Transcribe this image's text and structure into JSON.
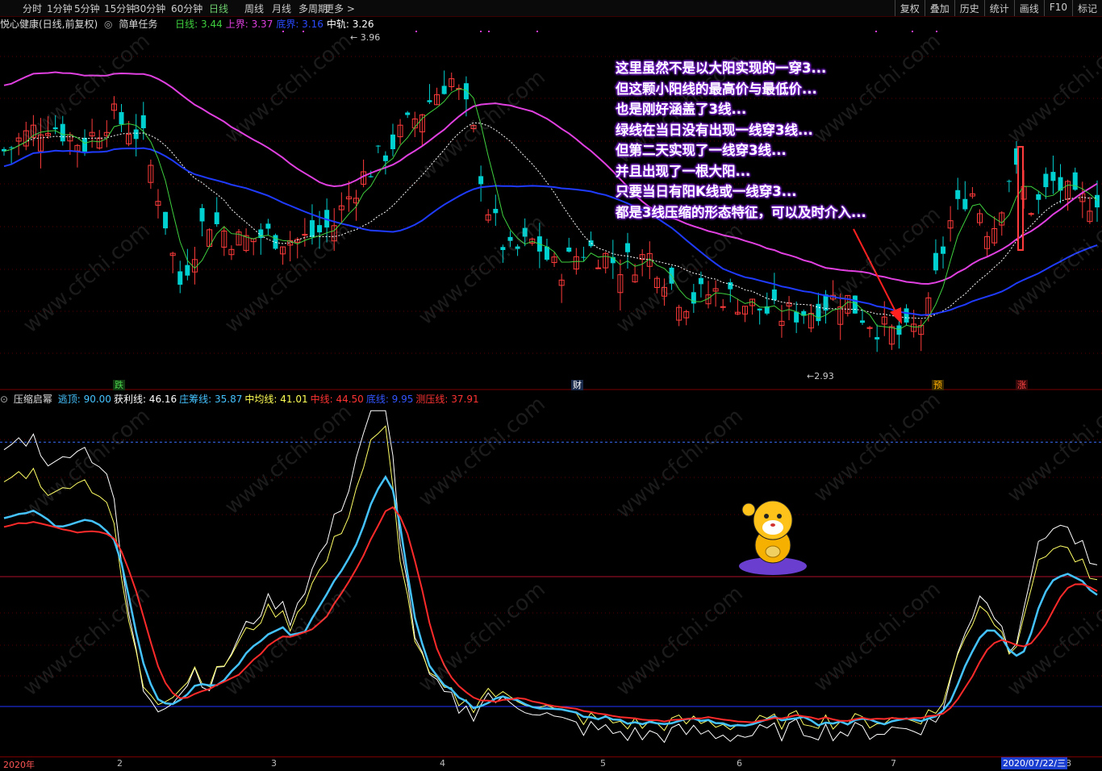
{
  "toolbar": {
    "periods": [
      "分时",
      "1分钟",
      "5分钟",
      "15分钟",
      "30分钟",
      "60分钟",
      "日线",
      "周线",
      "月线",
      "多周期",
      "更多 >"
    ],
    "active": "日线",
    "right_buttons": [
      "复权",
      "叠加",
      "历史",
      "统计",
      "画线",
      "F10",
      "标记"
    ]
  },
  "main_info": {
    "stock": "悦心健康(日线,前复权)",
    "task": "简单任务",
    "items": [
      {
        "label": "日线: 3.44",
        "color": "#3fd13f"
      },
      {
        "label": "上界: 3.37",
        "color": "#e040e0"
      },
      {
        "label": "底界: 3.16",
        "color": "#2a4bff"
      },
      {
        "label": "中轨: 3.26",
        "color": "#ffffff"
      }
    ]
  },
  "indicator_info": {
    "name": "压缩启幂",
    "items": [
      {
        "label": "逃顶: 90.00",
        "color": "#45c3ff"
      },
      {
        "label": "获利线: 46.16",
        "color": "#ffffff"
      },
      {
        "label": "庄筹线: 35.87",
        "color": "#45c3ff"
      },
      {
        "label": "中均线: 41.01",
        "color": "#ffff55"
      },
      {
        "label": "中线: 44.50",
        "color": "#ff3333"
      },
      {
        "label": "底线: 9.95",
        "color": "#3355ff"
      },
      {
        "label": "测压线: 37.91",
        "color": "#ff3333"
      }
    ]
  },
  "price_labels": {
    "high": "3.96",
    "low": "2.93"
  },
  "event_badges": [
    {
      "text": "跌",
      "color": "#4ad04a",
      "bg": "#123a12"
    },
    {
      "text": "财",
      "color": "#ffffff",
      "bg": "#1a2a4a"
    },
    {
      "text": "预",
      "color": "#ffb000",
      "bg": "#3a2a00"
    },
    {
      "text": "涨",
      "color": "#ff4444",
      "bg": "#3a0a0a"
    }
  ],
  "annotation": [
    "这里虽然不是以大阳实现的一穿3...",
    "但这颗小阳线的最高价与最低价...",
    "也是刚好涵盖了3线...",
    "绿线在当日没有出现一线穿3线...",
    "但第二天实现了一线穿3线...",
    "并且出现了一根大阳...",
    "只要当日有阳K线或一线穿3...",
    "都是3线压缩的形态特征，可以及时介入..."
  ],
  "x_axis": [
    "2020年",
    "2",
    "3",
    "4",
    "5",
    "6",
    "7",
    "8"
  ],
  "cursor_date": "2020/07/22/三",
  "watermark": "www.cfchi.com",
  "chart_data": {
    "type": "candlestick",
    "price_range": [
      2.85,
      4.05
    ],
    "indicator_range": [
      0,
      100
    ],
    "overlay_series": [
      {
        "name": "日线",
        "color": "#3fd13f",
        "last": 3.44
      },
      {
        "name": "上界",
        "color": "#e040e0",
        "last": 3.37
      },
      {
        "name": "底界",
        "color": "#2a4bff",
        "last": 3.16
      },
      {
        "name": "中轨",
        "color": "#ffffff",
        "last": 3.26
      }
    ],
    "indicator_series": [
      {
        "name": "获利线",
        "color": "#ffffff",
        "last": 46.16
      },
      {
        "name": "庄筹线",
        "color": "#45c3ff",
        "last": 35.87
      },
      {
        "name": "中均线",
        "color": "#ffff55",
        "last": 41.01
      },
      {
        "name": "中线",
        "color": "#ff3333",
        "last": 44.5
      },
      {
        "name": "测压线",
        "color": "#ff3333",
        "last": 37.91
      }
    ],
    "reference_lines": [
      90,
      9.95,
      50
    ]
  }
}
